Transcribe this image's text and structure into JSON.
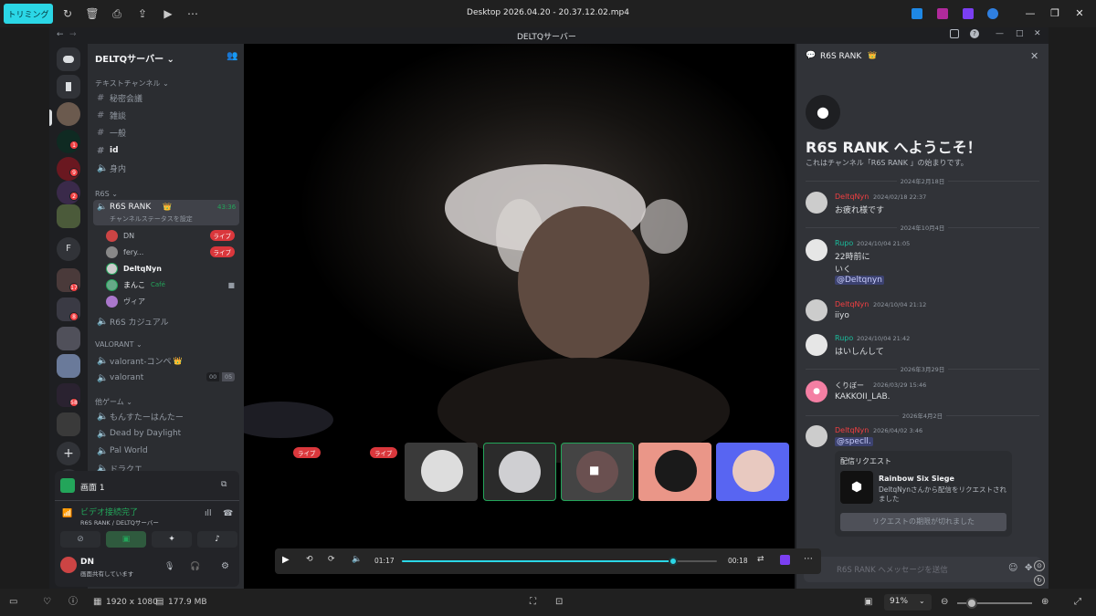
{
  "viewer": {
    "trim_label": "トリミング",
    "title": "Desktop 2026.04.20 - 20.37.12.02.mp4",
    "resolution": "1920 x 1080",
    "filesize": "177.9 MB",
    "zoom": "91%",
    "icons": [
      "rotate-icon",
      "trash-icon",
      "print-icon",
      "share-icon",
      "play-icon",
      "more-icon"
    ]
  },
  "discord": {
    "window_title": "DELTQサーバー",
    "server_name": "DELTQサーバー",
    "categories": {
      "text": "テキストチャンネル",
      "r6s": "R6S",
      "valorant": "VALORANT",
      "other": "他ゲーム"
    },
    "text_channels": [
      "秘密会議",
      "雑談",
      "一般",
      "id",
      "身内"
    ],
    "r6s_channel": {
      "name": "R6S RANK",
      "time": "43:36",
      "status": "チャンネルステータスを設定"
    },
    "members": [
      {
        "name": "DN",
        "live": "ライブ"
      },
      {
        "name": "fery...",
        "live": "ライブ"
      },
      {
        "name": "DeltqNyn"
      },
      {
        "name": "まんこ",
        "tag": "Café"
      },
      {
        "name": "ヴィア"
      }
    ],
    "r6s_casual": "R6S カジュアル",
    "valorant_channels": [
      {
        "name": "valorant-コンペ"
      },
      {
        "name": "valorant",
        "counts": [
          "00",
          "05"
        ]
      }
    ],
    "other_channels": [
      "もんすたーはんたー",
      "Dead by Daylight",
      "Pal World",
      "ドラクエ"
    ],
    "screen_panel": {
      "title": "画面 1"
    },
    "voice": {
      "status": "ビデオ接続完了",
      "location": "R6S RANK / DELTQサーバー"
    },
    "user": {
      "name": "DN",
      "status": "画面共有しています"
    },
    "guild_badges": [
      "1",
      "9",
      "2",
      "17",
      "8",
      "58"
    ],
    "guild_letter": "F"
  },
  "video": {
    "live_labels": [
      "ライブ",
      "ライブ"
    ],
    "current_time": "01:17",
    "remaining_time": "00:18",
    "progress": 0.86
  },
  "chat": {
    "header": "R6S RANK",
    "welcome_title": "R6S RANK へようこそ！",
    "welcome_sub": "これはチャンネル「R6S RANK 」の始まりです。",
    "messages": [
      {
        "divider": "2024年2月18日",
        "name": "DeltqNyn",
        "color": "#f23f42",
        "ts": "2024/02/18 22:37",
        "lines": [
          "お疲れ様です"
        ]
      },
      {
        "divider": "2024年10月4日",
        "name": "Rupo",
        "color": "#1abc9c",
        "ts": "2024/10/04 21:05",
        "lines": [
          "22時前に",
          "いく",
          "@Deltqnyn"
        ]
      },
      {
        "name": "DeltqNyn",
        "color": "#f23f42",
        "ts": "2024/10/04 21:12",
        "lines": [
          "iiyo"
        ]
      },
      {
        "name": "Rupo",
        "color": "#1abc9c",
        "ts": "2024/10/04 21:42",
        "lines": [
          "はいしんして"
        ]
      },
      {
        "divider": "2026年3月29日",
        "name": "くりぼー",
        "color": "#dbdee1",
        "ts": "2026/03/29 15:46",
        "lines": [
          "KAKKOII_LAB."
        ]
      },
      {
        "divider": "2026年4月2日",
        "name": "DeltqNyn",
        "color": "#f23f42",
        "ts": "2026/04/02 3:46",
        "lines": [
          "@specll."
        ]
      }
    ],
    "stream_request": {
      "title": "配信リクエスト",
      "game": "Rainbow Six Siege",
      "desc": "DeltqNynさんから配信をリクエストされました",
      "button": "リクエストの期限が切れました"
    },
    "input_placeholder": "R6S RANK へメッセージを送信"
  }
}
